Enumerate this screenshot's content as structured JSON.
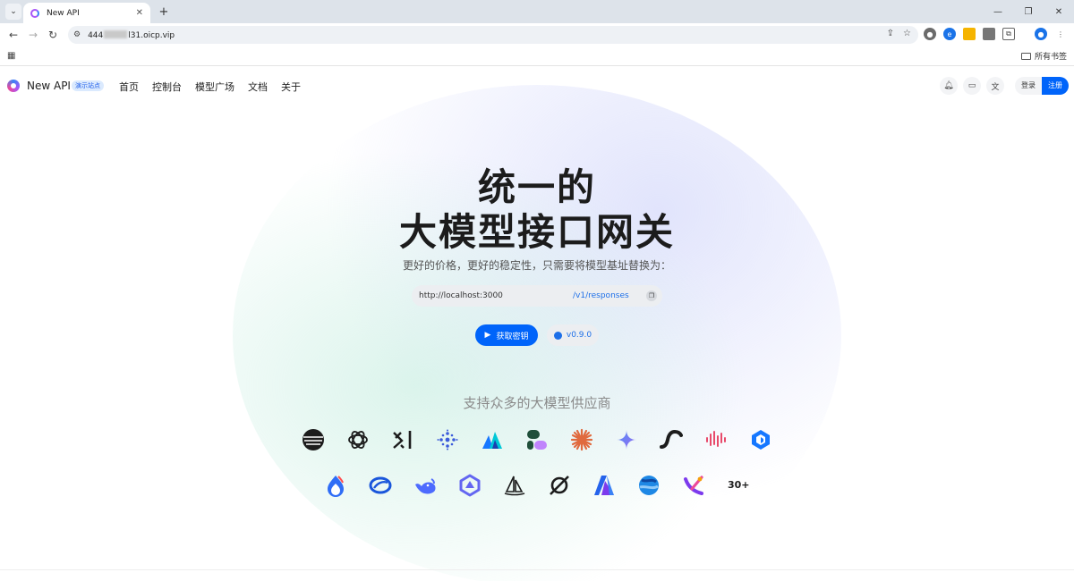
{
  "browser": {
    "tab_title": "New API",
    "url_prefix": "444",
    "url_suffix": "l31.oicp.vip",
    "bookmarks_label": "所有书签"
  },
  "site": {
    "name": "New API",
    "badge": "演示站点",
    "menu": [
      "首页",
      "控制台",
      "模型广场",
      "文档",
      "关于"
    ],
    "login": "登录",
    "register": "注册"
  },
  "hero": {
    "title_line1": "统一的",
    "title_line2": "大模型接口网关",
    "subtitle": "更好的价格，更好的稳定性，只需要将模型基址替换为：",
    "base_url": "http://localhost:3000",
    "path": "/v1/responses",
    "cta_label": "获取密钥",
    "version_label": "v0.9.0"
  },
  "providers": {
    "title": "支持众多的大模型供应商",
    "row1": [
      "moonshot-icon",
      "openai-icon",
      "xai-icon",
      "zhipu-icon",
      "volcengine-icon",
      "minimax-icon",
      "claude-icon",
      "gemini-icon",
      "suno-icon",
      "hailuo-icon",
      "qingyan-icon"
    ],
    "row2": [
      "wenxin-icon",
      "spark-icon",
      "deepseek-icon",
      "qwen-icon",
      "midjourney-icon",
      "grok-icon",
      "azure-icon",
      "hunyuan-icon",
      "kling-icon"
    ],
    "more_label": "30+"
  },
  "colors": {
    "accent": "#0064fa",
    "link": "#1d6fe8"
  }
}
